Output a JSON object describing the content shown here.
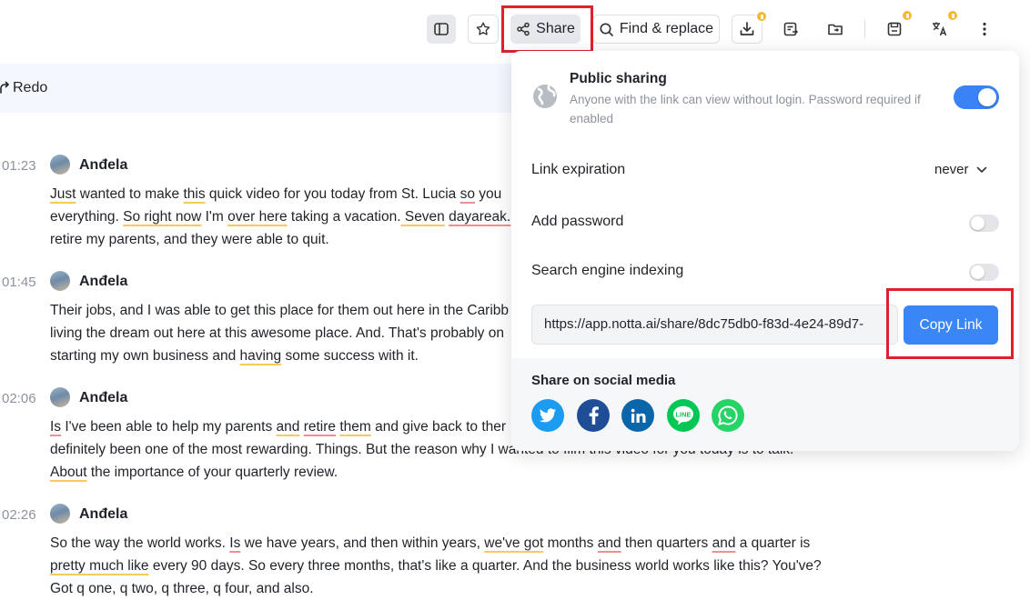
{
  "toolbar": {
    "share_label": "Share",
    "find_replace_label": "Find & replace",
    "icons": [
      "sidebar-toggle-icon",
      "star-icon",
      "share-icon",
      "search-icon",
      "download-icon",
      "export-icon",
      "folder-icon",
      "save-icon",
      "translate-icon",
      "more-vertical-icon"
    ]
  },
  "editor": {
    "redo_label": "Redo"
  },
  "transcript": [
    {
      "time": "01:23",
      "speaker": "Anđela",
      "lines": [
        [
          [
            "Just",
            "y"
          ],
          [
            " wanted to make ",
            ""
          ],
          [
            "this",
            "y"
          ],
          [
            " quick video for you today from St. Lucia ",
            ""
          ],
          [
            "so",
            "r"
          ],
          [
            " you",
            ""
          ]
        ],
        [
          [
            "everything. ",
            ""
          ],
          [
            "So right now",
            "y"
          ],
          [
            " I'm ",
            ""
          ],
          [
            "over here",
            "y"
          ],
          [
            " taking a vacation.",
            ""
          ],
          [
            " Seven",
            "y"
          ],
          [
            " ",
            ""
          ],
          [
            "dayareak.",
            "r"
          ]
        ],
        [
          [
            "retire my parents, and they were able to quit.",
            ""
          ]
        ]
      ]
    },
    {
      "time": "01:45",
      "speaker": "Anđela",
      "lines": [
        [
          [
            "Their jobs, and I was able to get this place for them out here in the Caribb",
            ""
          ]
        ],
        [
          [
            "living the dream out here at this awesome place. And. That's probably on",
            ""
          ]
        ],
        [
          [
            "starting my own business and ",
            ""
          ],
          [
            "having",
            "y"
          ],
          [
            " some success with it.",
            ""
          ]
        ]
      ]
    },
    {
      "time": "02:06",
      "speaker": "Anđela",
      "lines": [
        [
          [
            "Is",
            "r"
          ],
          [
            " I've been able to help my parents ",
            ""
          ],
          [
            "and",
            "y"
          ],
          [
            " ",
            ""
          ],
          [
            "retire",
            "r"
          ],
          [
            " ",
            ""
          ],
          [
            "them",
            "y"
          ],
          [
            " and give back to ther",
            ""
          ]
        ],
        [
          [
            "definitely been one of the most rewarding. Things. But the reason why I wanted to film this video for you today is to talk.",
            ""
          ]
        ],
        [
          [
            "About",
            "y"
          ],
          [
            " the importance of your quarterly review.",
            ""
          ]
        ]
      ]
    },
    {
      "time": "02:26",
      "speaker": "Anđela",
      "lines": [
        [
          [
            "So the way the world works. ",
            ""
          ],
          [
            "Is",
            "r"
          ],
          [
            " we have years, and then within years, ",
            ""
          ],
          [
            "we've got",
            "y"
          ],
          [
            " months ",
            ""
          ],
          [
            "and",
            "r"
          ],
          [
            " then quarters ",
            ""
          ],
          [
            "and",
            "r"
          ],
          [
            " a quarter is",
            ""
          ]
        ],
        [
          [
            "pretty much like",
            "y"
          ],
          [
            " every 90 days. So every three months, that's like a quarter. And the business world works like this? You've?",
            ""
          ]
        ],
        [
          [
            "Got q one, q two, q three, q four, and also.",
            ""
          ]
        ]
      ]
    }
  ],
  "share_panel": {
    "public_title": "Public sharing",
    "public_desc": "Anyone with the link can view without login. Password required if enabled",
    "public_enabled": true,
    "link_expiration_label": "Link expiration",
    "link_expiration_value": "never",
    "add_password_label": "Add password",
    "add_password_enabled": false,
    "seo_label": "Search engine indexing",
    "seo_enabled": false,
    "link_value": "https://app.notta.ai/share/8dc75db0-f83d-4e24-89d7-",
    "copy_label": "Copy Link",
    "social_title": "Share on social media",
    "social": [
      {
        "name": "twitter",
        "color": "#1d9bf0"
      },
      {
        "name": "facebook",
        "color": "#1f4e96"
      },
      {
        "name": "linkedin",
        "color": "#0a66a8"
      },
      {
        "name": "line",
        "color": "#06c755"
      },
      {
        "name": "whatsapp",
        "color": "#25d366"
      }
    ]
  }
}
